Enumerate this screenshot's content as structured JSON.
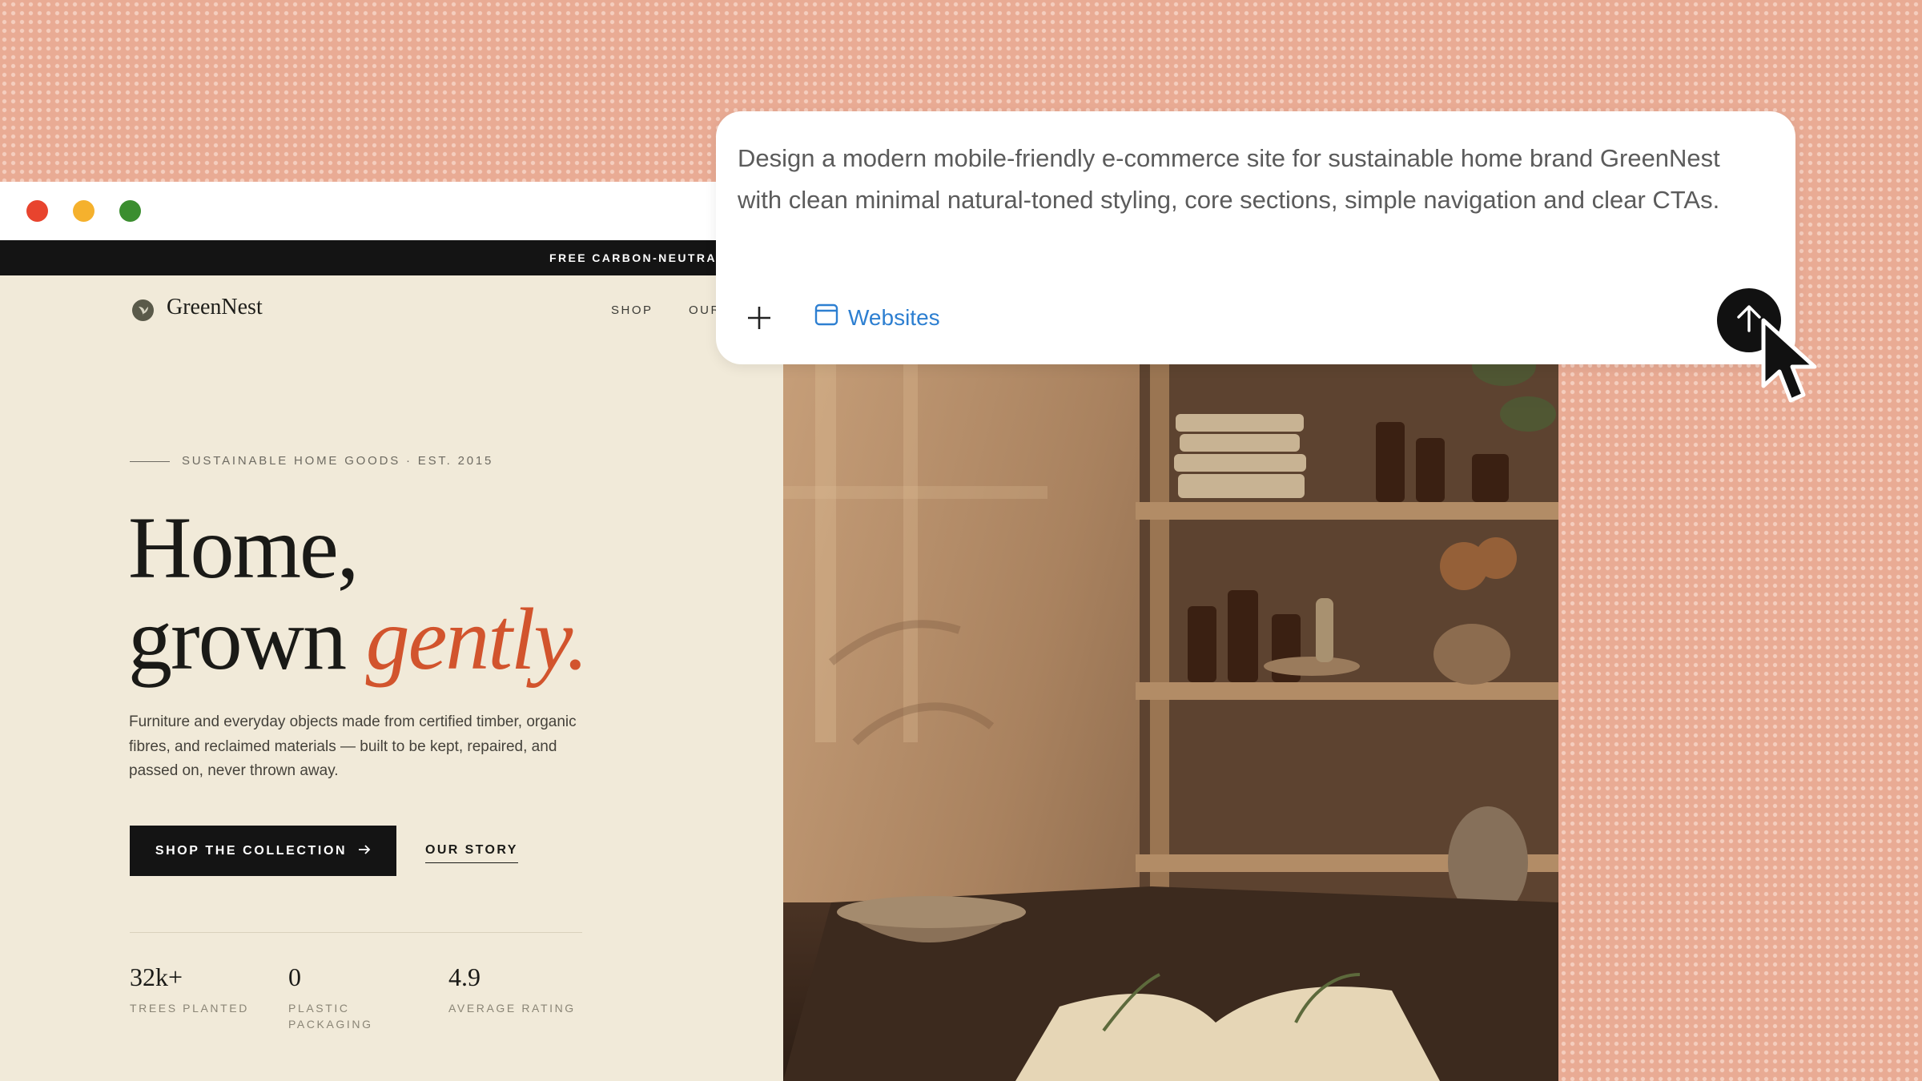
{
  "window": {
    "traffic_lights": [
      {
        "name": "close",
        "color": "#e8442e"
      },
      {
        "name": "minimize",
        "color": "#f5b12d"
      },
      {
        "name": "maximize",
        "color": "#3b8e2f"
      }
    ]
  },
  "site": {
    "promo_text": "FREE CARBON-NEUTRAL",
    "logo_text": "GreenNest",
    "nav": [
      "SHOP",
      "OUR"
    ],
    "eyebrow": "SUSTAINABLE HOME GOODS · EST. 2015",
    "headline_line1": "Home,",
    "headline_line2_plain": "grown",
    "headline_line2_accent": "gently.",
    "lead": "Furniture and everyday objects made from certified timber, organic fibres, and reclaimed materials — built to be kept, repaired, and passed on, never thrown away.",
    "cta_primary": "SHOP THE COLLECTION",
    "cta_primary_icon": "arrow-right-icon",
    "cta_secondary": "OUR STORY",
    "stats": [
      {
        "value": "32k+",
        "label": "TREES PLANTED"
      },
      {
        "value": "0",
        "label": "PLASTIC PACKAGING"
      },
      {
        "value": "4.9",
        "label": "AVERAGE RATING"
      }
    ],
    "accent_color": "#d2542d"
  },
  "prompt": {
    "text": "Design a modern mobile-friendly e-commerce site for sustainable home brand GreenNest with clean minimal natural-toned styling, core sections, simple navigation and clear CTAs.",
    "add_icon": "plus-icon",
    "mode_icon": "browser-window-icon",
    "mode_label": "Websites",
    "send_icon": "arrow-up-icon",
    "link_color": "#2d7fd1"
  }
}
